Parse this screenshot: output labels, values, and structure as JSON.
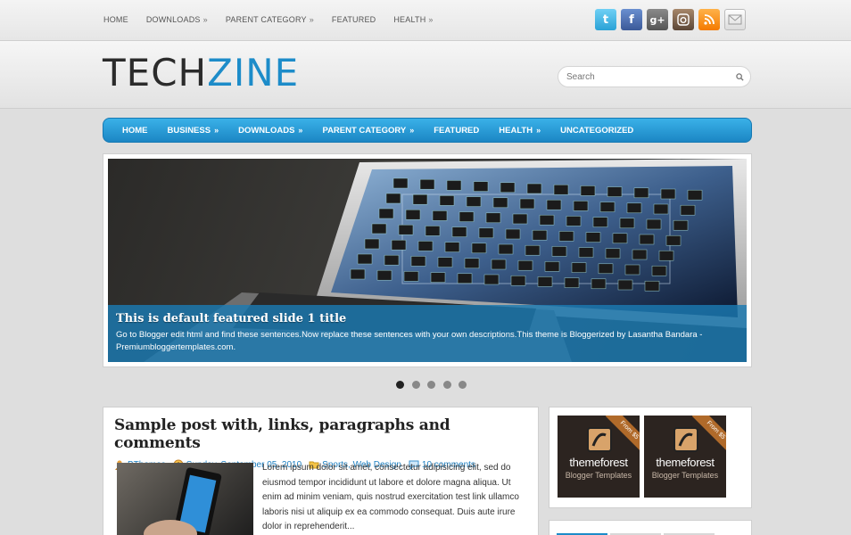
{
  "top_nav": [
    {
      "label": "HOME",
      "has_arrow": false
    },
    {
      "label": "DOWNLOADS",
      "has_arrow": true
    },
    {
      "label": "PARENT CATEGORY",
      "has_arrow": true
    },
    {
      "label": "FEATURED",
      "has_arrow": false
    },
    {
      "label": "HEALTH",
      "has_arrow": true
    }
  ],
  "arrow_glyph": "»",
  "social": [
    {
      "icon": "twitter-icon",
      "glyph": "t"
    },
    {
      "icon": "facebook-icon",
      "glyph": "f"
    },
    {
      "icon": "google-plus-icon",
      "glyph": "g+"
    },
    {
      "icon": "instagram-icon",
      "glyph": ""
    },
    {
      "icon": "rss-icon",
      "glyph": ""
    },
    {
      "icon": "email-icon",
      "glyph": ""
    }
  ],
  "logo": {
    "part1": "TECH",
    "part2": "ZINE"
  },
  "search": {
    "placeholder": "Search"
  },
  "main_nav": [
    {
      "label": "HOME",
      "has_arrow": false
    },
    {
      "label": "BUSINESS",
      "has_arrow": true
    },
    {
      "label": "DOWNLOADS",
      "has_arrow": true
    },
    {
      "label": "PARENT CATEGORY",
      "has_arrow": true
    },
    {
      "label": "FEATURED",
      "has_arrow": false
    },
    {
      "label": "HEALTH",
      "has_arrow": true
    },
    {
      "label": "UNCATEGORIZED",
      "has_arrow": false
    }
  ],
  "slider": {
    "title": "This is default featured slide 1 title",
    "description": "Go to Blogger edit html and find these sentences.Now replace these sentences with your own descriptions.This theme is Bloggerized by Lasantha Bandara - Premiumbloggertemplates.com.",
    "slide_count": 5,
    "active_index": 0
  },
  "post": {
    "title": "Sample post with, links, paragraphs and comments",
    "author": "BThemes",
    "date": "Sunday, September 05, 2010",
    "categories": "Sports, Web Design",
    "comments": "10 comments",
    "excerpt": "Lorem ipsum dolor sit amet, consectetur adipisicing elit, sed do eiusmod tempor incididunt ut labore et dolore magna aliqua. Ut enim ad minim veniam, quis nostrud exercitation test link ullamco laboris nisi ut aliquip ex ea commodo consequat. Duis aute irure dolor in reprehenderit..."
  },
  "ads": [
    {
      "ribbon": "From $5",
      "brand": "themeforest",
      "subtitle": "Blogger Templates"
    },
    {
      "ribbon": "From $5",
      "brand": "themeforest",
      "subtitle": "Blogger Templates"
    }
  ],
  "colors": {
    "accent": "#1d8cc9",
    "logo_dark": "#2b2b2b",
    "nav_top": "#3ab1e8",
    "nav_bottom": "#1b86c4"
  }
}
